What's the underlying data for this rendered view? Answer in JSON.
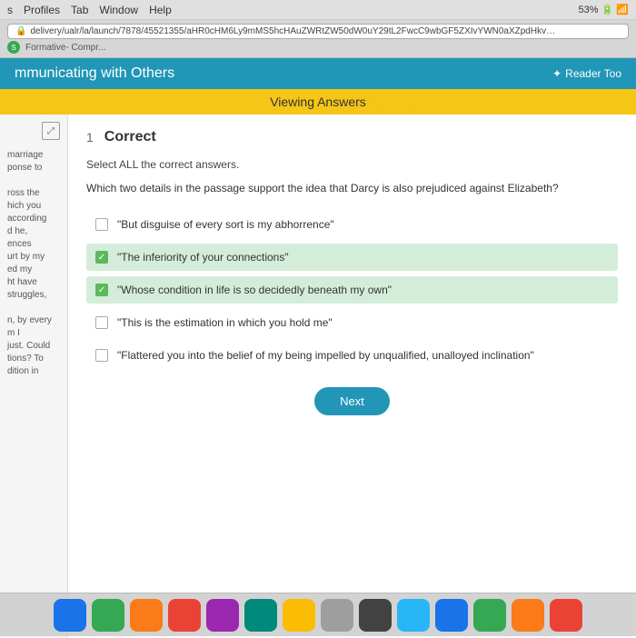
{
  "menubar": {
    "items": [
      "s",
      "Profiles",
      "Tab",
      "Window",
      "Help"
    ]
  },
  "browser": {
    "address": "delivery/ualr/la/launch/7878/45521355/aHR0cHM6Ly9mMS5hcHAuZWRtZW50dW0uY29tL2FwcC9wbGF5ZXIvYWN0aXZpdHkvNzg3OC80NTUyMTM1NS9sYQ...",
    "favicon": "S",
    "tab_label": "Formative- Compr..."
  },
  "header": {
    "title": "mmunicating with Others",
    "reader_tool_label": "Reader Too"
  },
  "banner": {
    "label": "Viewing Answers"
  },
  "sidebar": {
    "text": "marriage\nponse to\n\nross the\nhich you\naccording\nd he,\nences\nurt by my\ned my\nht have\nstruggles,\n\nn, by every\nm I\njust. Could\ntions? To\ndition in"
  },
  "question": {
    "number": "1",
    "status": "Correct",
    "instruction": "Select ALL the correct answers.",
    "text": "Which two details in the passage support the idea that Darcy is also prejudiced against Elizabeth?",
    "options": [
      {
        "id": "opt1",
        "text": "\"But disguise of every sort is my abhorrence\"",
        "checked": false,
        "correct": false
      },
      {
        "id": "opt2",
        "text": "\"The inferiority of your connections\"",
        "checked": true,
        "correct": true
      },
      {
        "id": "opt3",
        "text": "\"Whose condition in life is so decidedly beneath my own\"",
        "checked": true,
        "correct": true
      },
      {
        "id": "opt4",
        "text": "\"This is the estimation in which you hold me\"",
        "checked": false,
        "correct": false
      },
      {
        "id": "opt5",
        "text": "\"Flattered you into the belief of my being impelled by unqualified, unalloyed inclination\"",
        "checked": false,
        "correct": false
      }
    ],
    "next_button_label": "Next"
  }
}
